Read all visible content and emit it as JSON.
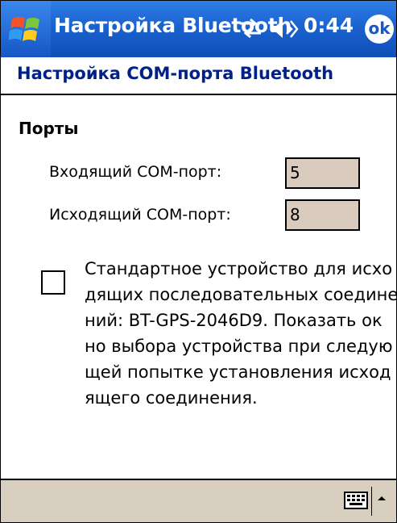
{
  "titlebar": {
    "title": "Настройка Bluetooth",
    "clock": "0:44",
    "ok_label": "ok",
    "icons": [
      "windows-start-icon",
      "connectivity-icon",
      "volume-icon"
    ]
  },
  "header": {
    "title": "Настройка COM-порта Bluetooth"
  },
  "ports": {
    "section_title": "Порты",
    "incoming_label": "Входящий COM-порт:",
    "incoming_value": "5",
    "outgoing_label": "Исходящий COM-порт:",
    "outgoing_value": "8"
  },
  "option": {
    "checked": false,
    "lines": [
      "Стандартное устройство для исхо",
      "дящих последовательных соедине",
      "ний: BT-GPS-2046D9. Показать ок",
      "но выбора устройства при следую",
      "щей попытке установления исход",
      "ящего соединения."
    ]
  },
  "menubar": {
    "icons": [
      "keyboard-icon",
      "up-arrow-icon"
    ]
  },
  "colors": {
    "titlebar": "#1a62d0",
    "header_text": "#00208a",
    "field_bg": "#d9ccbf",
    "menubar_bg": "#d8cfc1"
  }
}
